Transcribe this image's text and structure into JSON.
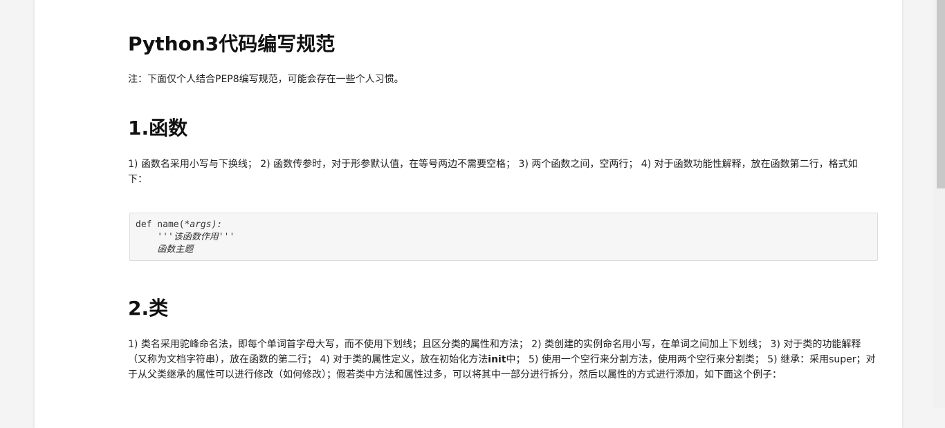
{
  "article": {
    "title": "Python3代码编写规范",
    "note": "注：下面仅个人结合PEP8编写规范，可能会存在一些个人习惯。",
    "sections": [
      {
        "heading": "1.函数",
        "paragraph": "1) 函数名采用小写与下换线； 2) 函数传参时，对于形参默认值，在等号两边不需要空格； 3) 两个函数之间，空两行； 4) 对于函数功能性解释，放在函数第二行，格式如下："
      },
      {
        "heading": "2.类",
        "paragraph_parts": {
          "before_bold": "1) 类名采用驼峰命名法，即每个单词首字母大写，而不使用下划线；且区分类的属性和方法； 2) 类创建的实例命名用小写，在单词之间加上下划线； 3) 对于类的功能解释（又称为文档字符串），放在函数的第二行； 4) 对于类的属性定义，放在初始化方法",
          "bold": "init",
          "after_bold": "中； 5) 使用一个空行来分割方法，使用两个空行来分割类； 5) 继承：采用super；对于从父类继承的属性可以进行修改（如何修改）；假若类中方法和属性过多，可以将其中一部分进行拆分，然后以属性的方式进行添加，如下面这个例子："
        }
      }
    ],
    "code_block": {
      "line1_def": "def name(",
      "line1_args": "*args):",
      "line2": "    '''该函数作用'''",
      "line3": "    函数主题"
    }
  }
}
